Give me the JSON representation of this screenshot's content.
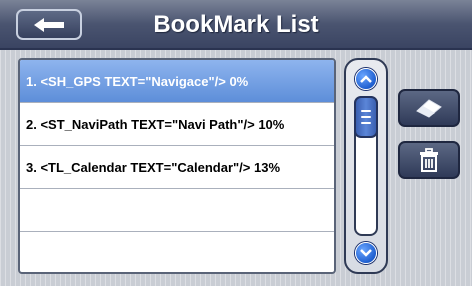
{
  "header": {
    "title": "BookMark List",
    "back_icon": "arrow-left-icon"
  },
  "bookmarks": [
    {
      "label": "1. <SH_GPS TEXT=\"Navigace\"/> 0%",
      "selected": true
    },
    {
      "label": "2. <ST_NaviPath TEXT=\"Navi Path\"/> 10%",
      "selected": false
    },
    {
      "label": "3. <TL_Calendar TEXT=\"Calendar\"/> 13%",
      "selected": false
    },
    {
      "label": "",
      "selected": false
    },
    {
      "label": "",
      "selected": false
    }
  ],
  "scrollbar": {
    "up_icon": "chevron-up-icon",
    "down_icon": "chevron-down-icon",
    "thumb_icon": "grip-lines-icon"
  },
  "actions": {
    "rename_icon": "eraser-icon",
    "delete_icon": "trash-icon"
  },
  "colors": {
    "selected_row": "#6f9ce3",
    "titlebar": "#4a5470",
    "scroll_button": "#1f5fd0"
  }
}
